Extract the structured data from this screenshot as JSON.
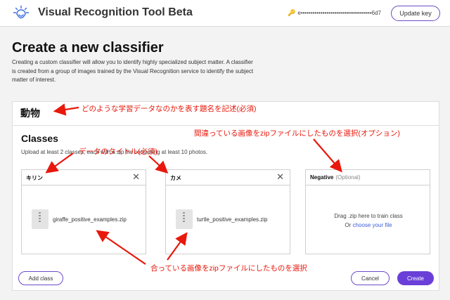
{
  "header": {
    "app_title": "Visual Recognition Tool Beta",
    "api_key_masked": "e••••••••••••••••••••••••••••••••••••6d7",
    "update_key_label": "Update key",
    "logo_icon": "ibm-watson-logo-icon",
    "key_icon": "key-icon"
  },
  "page": {
    "title": "Create a new classifier",
    "description": "Creating a custom classifier will allow you to identify highly specialized subject matter. A classifier is created from a group of images trained by the Visual Recognition service to identify the subject matter of interest."
  },
  "classifier_name": "動物",
  "classes_section": {
    "title": "Classes",
    "description": "Upload at least 2 classes, each with a zip file containing at least 10 photos.",
    "classes": [
      {
        "name": "キリン",
        "file": "giraffe_positive_examples.zip"
      },
      {
        "name": "カメ",
        "file": "turtle_positive_examples.zip"
      }
    ],
    "negative": {
      "name": "Negative",
      "optional": "(Optional)",
      "drop_text": "Drag .zip here to train class",
      "or_text": "Or",
      "choose_link": "choose your file"
    },
    "add_class_label": "Add class",
    "cancel_label": "Cancel",
    "create_label": "Create"
  },
  "annotations": {
    "name_note": "どのような学習データなのかを表す題名を記述(必須)",
    "negative_note": "間違っている画像をzipファイルにしたものを選択(オプション)",
    "title_note": "データのタイトル(必須)",
    "positive_note": "合っている画像をzipファイルにしたものを選択",
    "color": "#e8180c"
  },
  "colors": {
    "accent": "#6a3fd8",
    "annotation": "#e8180c"
  }
}
